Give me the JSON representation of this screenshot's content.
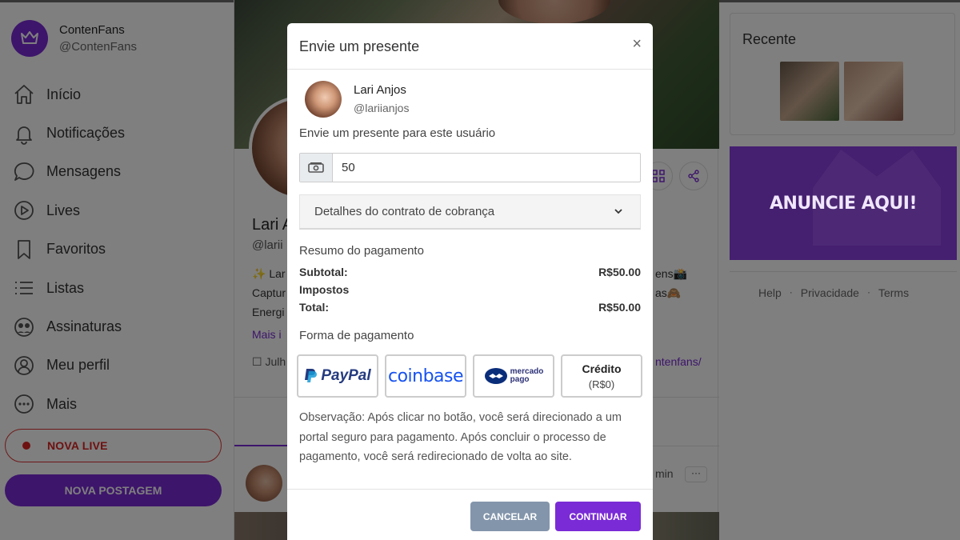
{
  "brand": {
    "name": "ContenFans",
    "handle": "@ContenFans"
  },
  "sidebar": {
    "items": [
      {
        "label": "Início",
        "icon": "home-icon"
      },
      {
        "label": "Notificações",
        "icon": "bell-icon"
      },
      {
        "label": "Mensagens",
        "icon": "chat-icon"
      },
      {
        "label": "Lives",
        "icon": "play-icon"
      },
      {
        "label": "Favoritos",
        "icon": "bookmark-icon"
      },
      {
        "label": "Listas",
        "icon": "list-icon"
      },
      {
        "label": "Assinaturas",
        "icon": "subscriptions-icon"
      },
      {
        "label": "Meu perfil",
        "icon": "user-icon"
      },
      {
        "label": "Mais",
        "icon": "more-icon"
      }
    ],
    "live_button": "NOVA LIVE",
    "post_button": "NOVA POSTAGEM"
  },
  "profile": {
    "name_partial": "Lari A",
    "handle_partial": "@larii",
    "bio_line1": "✨ Lar",
    "bio_line2": "Captur",
    "bio_line3": "Energi",
    "bio_right1": "ens📸",
    "bio_right2": "as🙈",
    "more_link": "Mais i",
    "date_partial": "Julh",
    "link_partial": "ntenfans/",
    "post_time": "min",
    "post_menu": "···"
  },
  "right": {
    "recent_title": "Recente",
    "ad_text": "ANUNCIE AQUI!",
    "footer": [
      "Help",
      "Privacidade",
      "Terms"
    ]
  },
  "modal": {
    "title": "Envie um presente",
    "close": "×",
    "user": {
      "name": "Lari Anjos",
      "handle": "@lariianjos"
    },
    "description": "Envie um presente para este usuário",
    "amount": "50",
    "billing_select": "Detalhes do contrato de cobrança",
    "summary_title": "Resumo do pagamento",
    "subtotal_label": "Subtotal:",
    "subtotal_value": "R$50.00",
    "taxes_label": "Impostos",
    "total_label": "Total:",
    "total_value": "R$50.00",
    "payment_title": "Forma de pagamento",
    "payment_methods": {
      "paypal": "PayPal",
      "coinbase": "coinbase",
      "mercado_line1": "mercado",
      "mercado_line2": "pago",
      "credit_label": "Crédito",
      "credit_value": "(R$0)"
    },
    "note": "Observação: Após clicar no botão, você será direcionado a um portal seguro para pagamento. Após concluir o processo de pagamento, você será redirecionado de volta ao site.",
    "cancel": "CANCELAR",
    "continue": "CONTINUAR"
  },
  "colors": {
    "accent": "#7a2bd6",
    "live": "#d22222",
    "cancel": "#8395ab"
  }
}
